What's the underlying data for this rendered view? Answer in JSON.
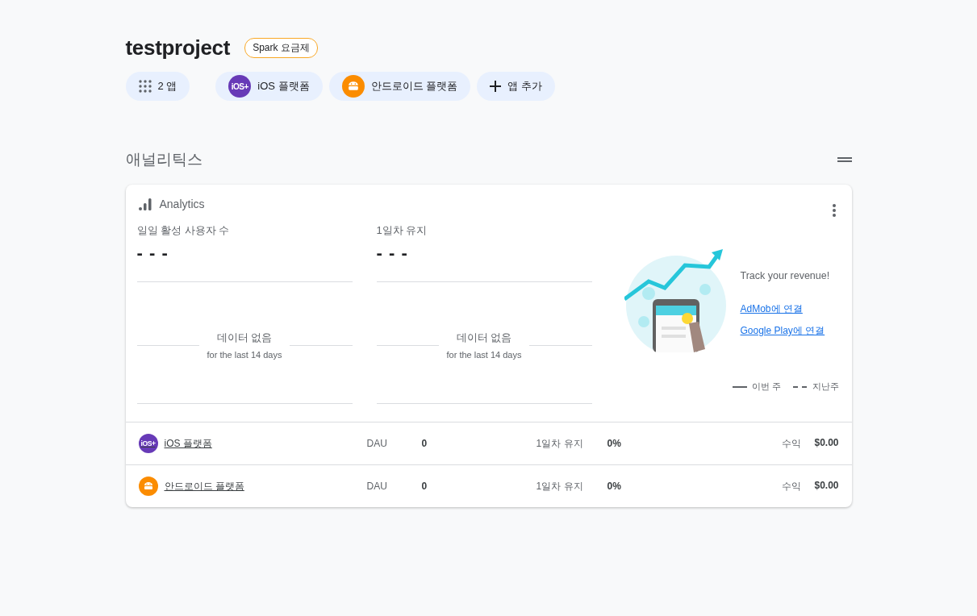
{
  "project": {
    "title": "testproject",
    "plan": "Spark 요금제"
  },
  "app_chips": [
    {
      "kind": "count",
      "label": "2 앱"
    },
    {
      "kind": "ios",
      "badge": "iOS+",
      "label": "iOS 플랫폼"
    },
    {
      "kind": "android",
      "label": "안드로이드 플랫폼"
    },
    {
      "kind": "add",
      "label": "앱 추가"
    }
  ],
  "section": {
    "title": "애널리틱스"
  },
  "card": {
    "title": "Analytics",
    "metrics": [
      {
        "label": "일일 활성 사용자 수",
        "value": "- - -",
        "empty_title": "데이터 없음",
        "empty_subtitle": "for the last 14 days"
      },
      {
        "label": "1일차 유지",
        "value": "- - -",
        "empty_title": "데이터 없음",
        "empty_subtitle": "for the last 14 days"
      }
    ],
    "promo": {
      "title": "Track your revenue!",
      "links": [
        "AdMob에 연결",
        "Google Play에 연결"
      ]
    },
    "legend": [
      {
        "kind": "solid",
        "label": "이번 주"
      },
      {
        "kind": "dashed",
        "label": "지난주"
      }
    ],
    "apps": [
      {
        "kind": "ios",
        "badge": "iOS+",
        "name": "iOS 플랫폼",
        "dau_label": "DAU",
        "dau": "0",
        "retention_label": "1일차 유지",
        "retention": "0%",
        "revenue_label": "수익",
        "revenue": "$0.00"
      },
      {
        "kind": "android",
        "name": "안드로이드 플랫폼",
        "dau_label": "DAU",
        "dau": "0",
        "retention_label": "1일차 유지",
        "retention": "0%",
        "revenue_label": "수익",
        "revenue": "$0.00"
      }
    ]
  }
}
